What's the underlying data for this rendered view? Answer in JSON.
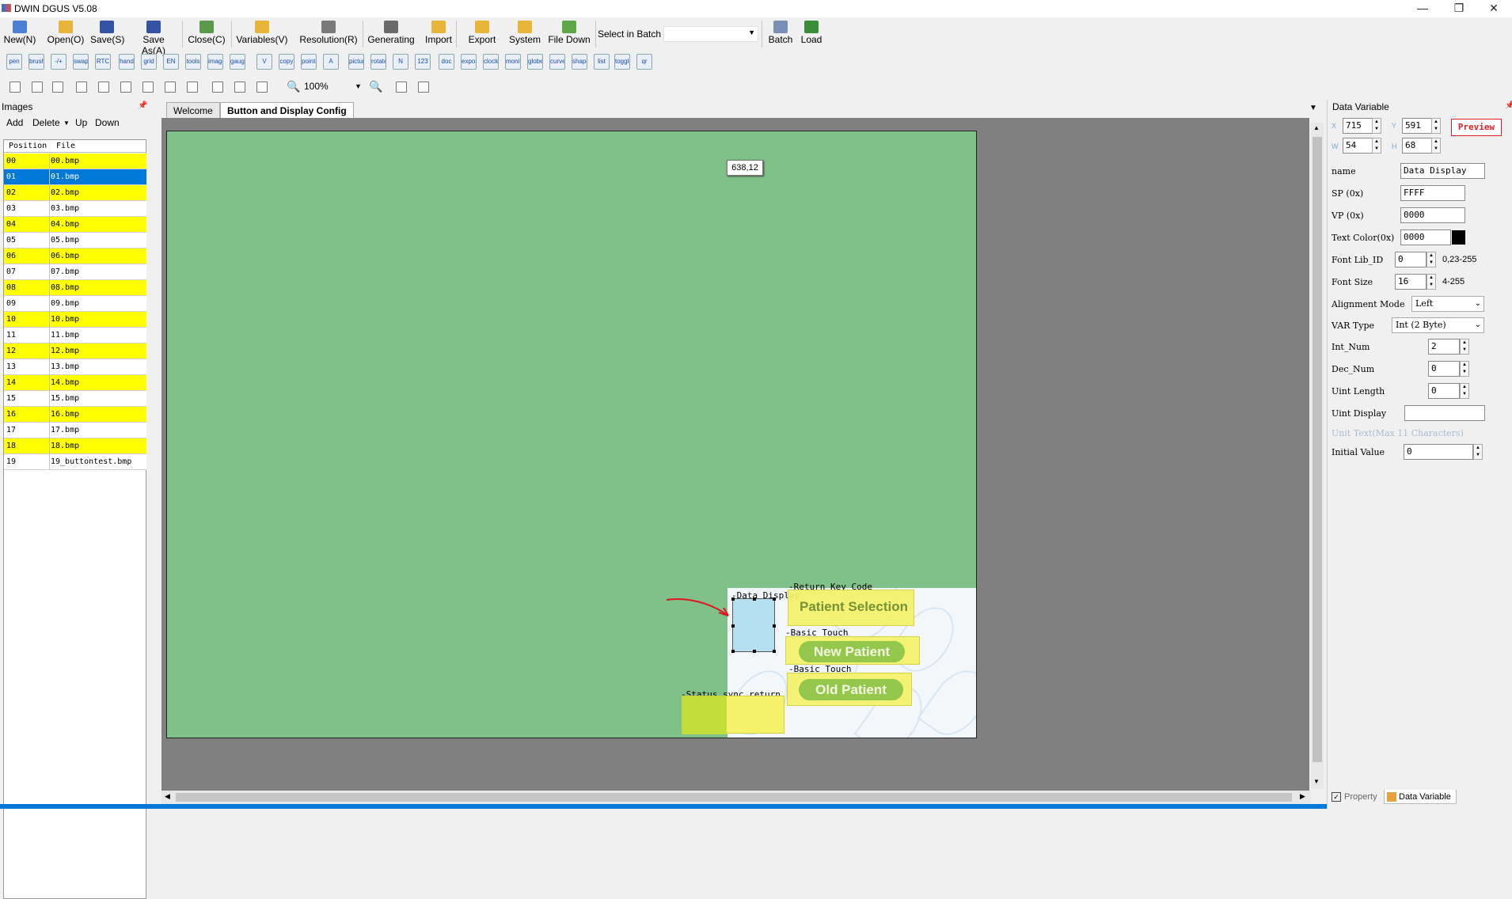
{
  "window": {
    "title": "DWIN DGUS V5.08",
    "controls": [
      "—",
      "❐",
      "✕"
    ]
  },
  "toolbar": {
    "buttons": [
      {
        "label": "New(N)",
        "color": "#4a7fd4"
      },
      {
        "label": "Open(O)",
        "color": "#e7b53a"
      },
      {
        "label": "Save(S)",
        "color": "#3453a5"
      },
      {
        "label": "Save As(A)",
        "color": "#3453a5"
      },
      {
        "label": "Close(C)",
        "color": "#5b9a4d"
      },
      {
        "label": "Variables(V)",
        "color": "#e7b53a"
      },
      {
        "label": "Resolution(R)",
        "color": "#7a7a7a"
      },
      {
        "label": "Generating",
        "color": "#6a6a6a"
      },
      {
        "label": "Import",
        "color": "#e7b53a"
      },
      {
        "label": "Export",
        "color": "#e7b53a"
      },
      {
        "label": "System",
        "color": "#e7b53a"
      },
      {
        "label": "File Down",
        "color": "#5fa84a"
      }
    ],
    "select_in_batch_label": "Select in Batch",
    "select_in_batch_value": "",
    "batch_label": "Batch",
    "load_label": "Load"
  },
  "toolbar2": {
    "icons": [
      "pen",
      "brush",
      "-/+",
      "swap",
      "RTC",
      "hand",
      "grid",
      "EN",
      "tools",
      "image",
      "gauge",
      "V",
      "copy",
      "pointer",
      "A",
      "picture",
      "rotate",
      "N",
      "123",
      "doc",
      "export",
      "clock",
      "monitor",
      "globe",
      "curve",
      "shape",
      "list",
      "toggle",
      "qr"
    ]
  },
  "toolbar3": {
    "zoom_value": "100%"
  },
  "images_panel": {
    "title": "Images",
    "pin": "📌",
    "tools": {
      "add": "Add",
      "delete": "Delete",
      "up": "Up",
      "down": "Down"
    },
    "columns": {
      "position": "Position",
      "file": "File"
    },
    "rows": [
      {
        "position": "00",
        "file": "00.bmp"
      },
      {
        "position": "01",
        "file": "01.bmp"
      },
      {
        "position": "02",
        "file": "02.bmp"
      },
      {
        "position": "03",
        "file": "03.bmp"
      },
      {
        "position": "04",
        "file": "04.bmp"
      },
      {
        "position": "05",
        "file": "05.bmp"
      },
      {
        "position": "06",
        "file": "06.bmp"
      },
      {
        "position": "07",
        "file": "07.bmp"
      },
      {
        "position": "08",
        "file": "08.bmp"
      },
      {
        "position": "09",
        "file": "09.bmp"
      },
      {
        "position": "10",
        "file": "10.bmp"
      },
      {
        "position": "11",
        "file": "11.bmp"
      },
      {
        "position": "12",
        "file": "12.bmp"
      },
      {
        "position": "13",
        "file": "13.bmp"
      },
      {
        "position": "14",
        "file": "14.bmp"
      },
      {
        "position": "15",
        "file": "15.bmp"
      },
      {
        "position": "16",
        "file": "16.bmp"
      },
      {
        "position": "17",
        "file": "17.bmp"
      },
      {
        "position": "18",
        "file": "18.bmp"
      },
      {
        "position": "19",
        "file": "19_buttontest.bmp"
      }
    ]
  },
  "tabs": {
    "welcome": "Welcome",
    "config": "Button and Display Config"
  },
  "canvas": {
    "coord_tooltip": "638,12",
    "labels": {
      "data_display": "Data Display",
      "return_key_code": "Return Key Code",
      "basic_touch_1": "Basic Touch",
      "basic_touch_2": "Basic Touch",
      "status_sync": "Status sync return"
    },
    "buttons": {
      "patient_selection": "Patient Selection",
      "new_patient": "New Patient",
      "old_patient": "Old Patient"
    }
  },
  "data_variable": {
    "title": "Data Variable",
    "x_label": "X",
    "x": "715",
    "y_label": "Y",
    "y": "591",
    "w_label": "W",
    "w": "54",
    "h_label": "H",
    "h": "68",
    "preview": "Preview",
    "fields": {
      "name_label": "name",
      "name": "Data Display",
      "sp_label": "SP (0x)",
      "sp": "FFFF",
      "vp_label": "VP (0x)",
      "vp": "0000",
      "text_color_label": "Text Color(0x)",
      "text_color": "0000",
      "font_lib_label": "Font Lib_ID",
      "font_lib": "0",
      "font_lib_range": "0,23-255",
      "font_size_label": "Font Size",
      "font_size": "16",
      "font_size_range": "4-255",
      "align_label": "Alignment Mode",
      "align": "Left",
      "var_type_label": "VAR Type",
      "var_type": "Int (2 Byte)",
      "int_num_label": "Int_Num",
      "int_num": "2",
      "dec_num_label": "Dec_Num",
      "dec_num": "0",
      "uint_length_label": "Uint Length",
      "uint_length": "0",
      "uint_display_label": "Uint Display",
      "uint_display": "",
      "unit_text_label": "Unit Text(Max 11 Characters)",
      "initial_label": "Initial Value",
      "initial": "0"
    },
    "bottom_tabs": {
      "property": "Property",
      "data_variable": "Data Variable"
    }
  },
  "colors": {
    "canvas_green": "#80c18a",
    "selection_blue": "#0078d7",
    "highlight_yellow": "#ffff00",
    "arrow_red": "#e0141e"
  }
}
